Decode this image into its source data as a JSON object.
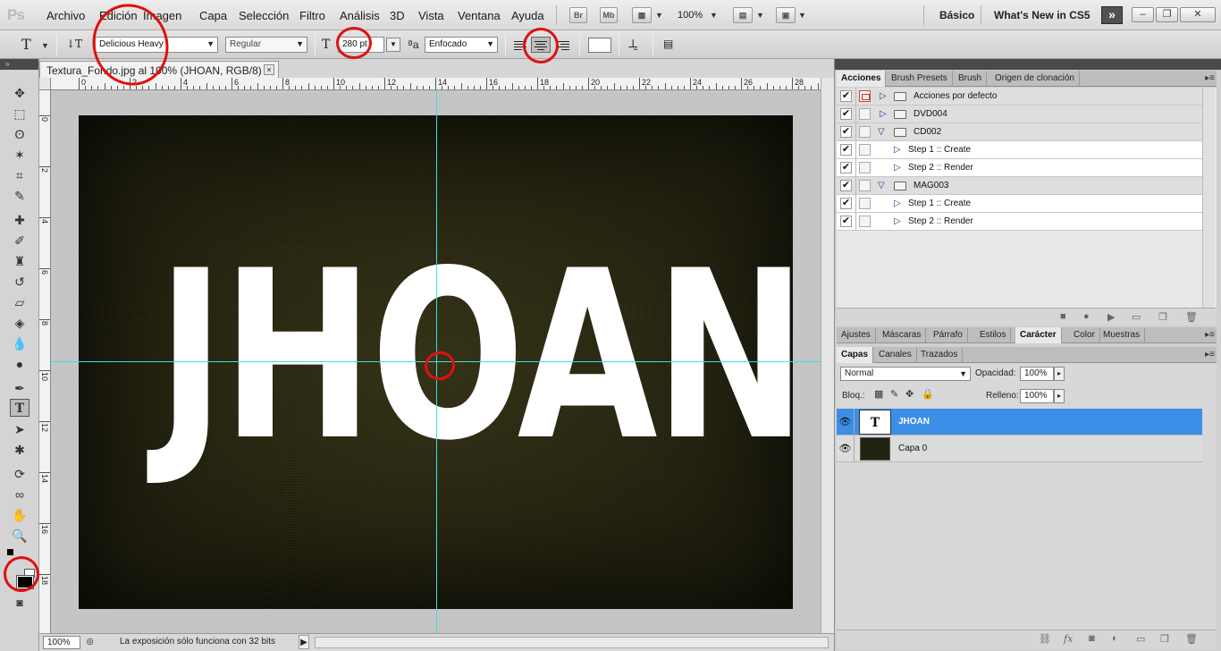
{
  "menubar": {
    "logo": "Ps",
    "items": [
      "Archivo",
      "Edición",
      "Imagen",
      "Capa",
      "Selección",
      "Filtro",
      "Análisis",
      "3D",
      "Vista",
      "Ventana",
      "Ayuda"
    ],
    "bridge_label": "Br",
    "minibridge_label": "Mb",
    "zoom": "100%",
    "workspace_basic": "Básico",
    "workspace_new": "What's New in CS5",
    "more_label": "»"
  },
  "options": {
    "tool_glyph": "T",
    "font_family": "Delicious Heavy",
    "font_style": "Regular",
    "font_size": "280 pt",
    "antialias_glyph": "ªa",
    "antialias": "Enfocado"
  },
  "document": {
    "tab_title": "Textura_Fondo.jpg al 100% (JHOAN, RGB/8) *",
    "close_label": "×",
    "canvas_text": "JHOAN",
    "ruler_h": [
      "0",
      "2",
      "4",
      "6",
      "8",
      "10",
      "12",
      "14",
      "16",
      "18",
      "20",
      "22",
      "24",
      "26",
      "28"
    ],
    "ruler_v": [
      "0",
      "2",
      "4",
      "6",
      "8",
      "10",
      "12",
      "14",
      "16",
      "18"
    ],
    "zoom": "100%",
    "status": "La exposición sólo funciona con 32 bits"
  },
  "actions_panel": {
    "tabs": [
      "Acciones",
      "Brush Presets",
      "Brush",
      "Origen de clonación"
    ],
    "rows": [
      {
        "label": "Acciones por defecto",
        "type": "set",
        "expanded": false
      },
      {
        "label": "DVD004",
        "type": "set",
        "expanded": false
      },
      {
        "label": "CD002",
        "type": "set",
        "expanded": true
      },
      {
        "label": "Step 1 :: Create",
        "type": "step"
      },
      {
        "label": "Step 2 :: Render",
        "type": "step"
      },
      {
        "label": "MAG003",
        "type": "set",
        "expanded": true
      },
      {
        "label": "Step 1 :: Create",
        "type": "step"
      },
      {
        "label": "Step 2 :: Render",
        "type": "step"
      }
    ]
  },
  "adjust_tabs": [
    "Ajustes",
    "Máscaras",
    "Párrafo",
    "Estilos",
    "Carácter",
    "Color",
    "Muestras"
  ],
  "layers_panel": {
    "tabs": [
      "Capas",
      "Canales",
      "Trazados"
    ],
    "blend_mode": "Normal",
    "opacity_label": "Opacidad:",
    "opacity": "100%",
    "lock_label": "Bloq.:",
    "fill_label": "Relleno:",
    "fill": "100%",
    "layers": [
      {
        "name": "JHOAN",
        "kind": "text",
        "selected": true
      },
      {
        "name": "Capa 0",
        "kind": "image",
        "selected": false
      }
    ]
  }
}
